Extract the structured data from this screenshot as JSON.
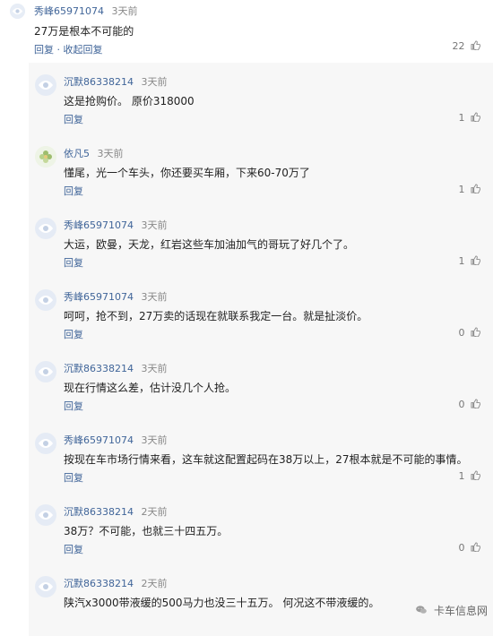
{
  "top_comment": {
    "username": "秀峰65971074",
    "time": "3天前",
    "text": "27万是根本不可能的",
    "actions": [
      "回复",
      "收起回复"
    ],
    "separator": "·",
    "like_icon": "thumb-up-icon",
    "like_count": "22"
  },
  "replies": [
    {
      "username": "沉默86338214",
      "time": "3天前",
      "text": "这是抢购价。 原价318000",
      "reply_label": "回复",
      "like_count": "1",
      "avatar_icon": "default-avatar-icon"
    },
    {
      "username": "依凡5",
      "time": "3天前",
      "text": "懂尾，光一个车头，你还要买车厢，下来60-70万了",
      "reply_label": "回复",
      "like_count": "1",
      "avatar_icon": "flower-avatar-icon"
    },
    {
      "username": "秀峰65971074",
      "time": "3天前",
      "text": "大运，欧曼，天龙，红岩这些车加油加气的哥玩了好几个了。",
      "reply_label": "回复",
      "like_count": "1",
      "avatar_icon": "default-avatar-icon"
    },
    {
      "username": "秀峰65971074",
      "time": "3天前",
      "text": "呵呵，抢不到，27万卖的话现在就联系我定一台。就是扯淡价。",
      "reply_label": "回复",
      "like_count": "0",
      "avatar_icon": "default-avatar-icon"
    },
    {
      "username": "沉默86338214",
      "time": "3天前",
      "text": "现在行情这么差，估计没几个人抢。",
      "reply_label": "回复",
      "like_count": "0",
      "avatar_icon": "default-avatar-icon"
    },
    {
      "username": "秀峰65971074",
      "time": "3天前",
      "text": "按现在车市场行情来看，这车就这配置起码在38万以上，27根本就是不可能的事情。",
      "reply_label": "回复",
      "like_count": "1",
      "avatar_icon": "default-avatar-icon"
    },
    {
      "username": "沉默86338214",
      "time": "2天前",
      "text": "38万？不可能，也就三十四五万。",
      "reply_label": "回复",
      "like_count": "0",
      "avatar_icon": "default-avatar-icon"
    },
    {
      "username": "沉默86338214",
      "time": "2天前",
      "text": "陕汽x3000带液缓的500马力也没三十五万。 何况这不带液缓的。",
      "reply_label": "回复",
      "like_count": "",
      "avatar_icon": "default-avatar-icon"
    }
  ],
  "watermark": {
    "text": "卡车信息网",
    "icon": "wechat-icon"
  },
  "colors": {
    "username": "#406599",
    "reply_background": "#f7f7f7",
    "meta_text": "#888888",
    "body_text": "#222222"
  }
}
